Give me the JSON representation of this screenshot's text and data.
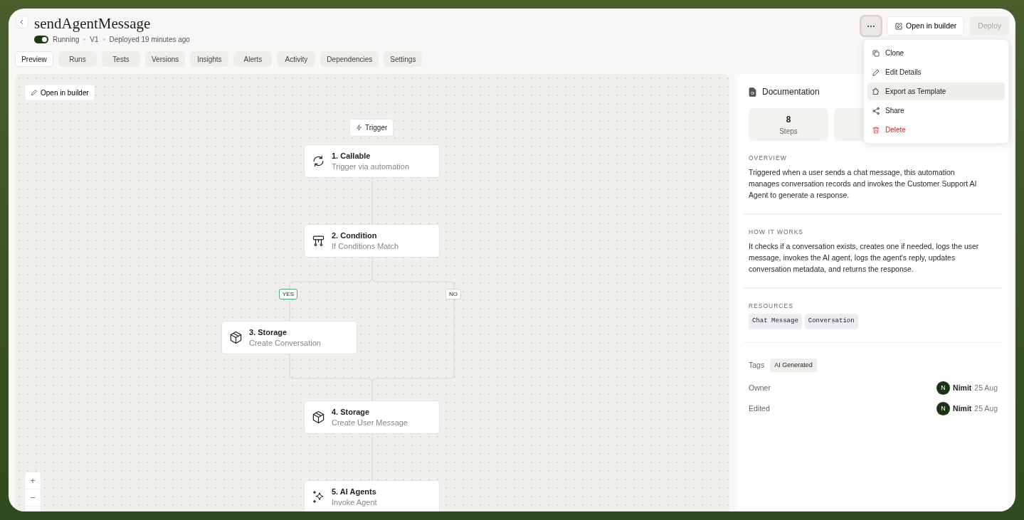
{
  "header": {
    "title": "sendAgentMessage",
    "running": true,
    "status": "Running",
    "version": "V1",
    "deployed": "Deployed 19 minutes ago"
  },
  "actions": {
    "more_expanded": true,
    "open_in_builder": "Open in builder",
    "deploy": {
      "label": "Deploy",
      "disabled": true
    }
  },
  "tabs": [
    {
      "label": "Preview",
      "selected": true
    },
    {
      "label": "Runs",
      "selected": false
    },
    {
      "label": "Tests",
      "selected": false
    },
    {
      "label": "Versions",
      "selected": false
    },
    {
      "label": "Insights",
      "selected": false
    },
    {
      "label": "Alerts",
      "selected": false
    },
    {
      "label": "Activity",
      "selected": false
    },
    {
      "label": "Dependencies",
      "selected": false
    },
    {
      "label": "Settings",
      "selected": false
    }
  ],
  "menu": {
    "items": [
      {
        "label": "Clone",
        "kind": "clone",
        "highlighted": false
      },
      {
        "label": "Edit Details",
        "kind": "edit",
        "highlighted": false
      },
      {
        "label": "Export as Template",
        "kind": "export",
        "highlighted": true
      },
      {
        "label": "Share",
        "kind": "share",
        "highlighted": false
      },
      {
        "label": "Delete",
        "kind": "delete",
        "highlighted": false
      }
    ]
  },
  "canvas": {
    "open_in_builder": "Open in builder",
    "trigger": "Trigger",
    "nodes": [
      {
        "title": "1. Callable",
        "subtitle": "Trigger via automation",
        "kind": "callable"
      },
      {
        "title": "2. Condition",
        "subtitle": "If Conditions Match",
        "kind": "condition"
      },
      {
        "title": "3. Storage",
        "subtitle": "Create Conversation",
        "kind": "storage"
      },
      {
        "title": "4. Storage",
        "subtitle": "Create User Message",
        "kind": "storage"
      },
      {
        "title": "5. AI Agents",
        "subtitle": "Invoke Agent",
        "kind": "agent"
      }
    ],
    "branches": [
      {
        "label": "YES",
        "highlighted": true
      },
      {
        "label": "NO",
        "highlighted": false
      }
    ],
    "zoom": [
      "+",
      "−"
    ]
  },
  "documentation": {
    "title": "Documentation",
    "stats": [
      {
        "value": "8",
        "label": "Steps"
      }
    ],
    "sections": [
      {
        "heading": "OVERVIEW",
        "body": "Triggered when a user sends a chat message, this automation manages conversation records and invokes the Customer Support AI Agent to generate a response."
      },
      {
        "heading": "HOW IT WORKS",
        "body": "It checks if a conversation exists, creates one if needed, logs the user message, invokes the AI agent, logs the agent's reply, updates conversation metadata, and returns the response."
      }
    ],
    "resources": {
      "heading": "RESOURCES",
      "items": [
        "Chat Message",
        "Conversation"
      ]
    },
    "tags": {
      "label": "Tags",
      "items": [
        "AI Generated"
      ]
    },
    "people": [
      {
        "label": "Owner",
        "avatar": "N",
        "name": "Nimit",
        "date": "25 Aug"
      },
      {
        "label": "Edited",
        "avatar": "N",
        "name": "Nimit",
        "date": "25 Aug"
      }
    ]
  }
}
